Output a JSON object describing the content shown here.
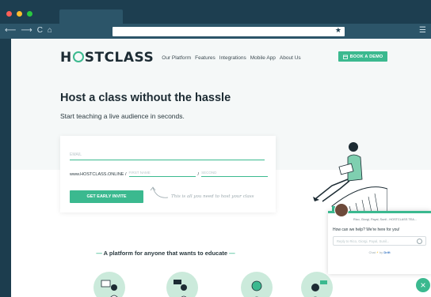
{
  "browser": {
    "nav_back": "⟵",
    "nav_forward": "⟶",
    "reload": "C",
    "home": "⌂",
    "star": "★",
    "menu": "☰",
    "dot_colors": [
      "#ff5f57",
      "#febc2e",
      "#28c840"
    ]
  },
  "header": {
    "logo_left": "H",
    "logo_right": "STCLASS",
    "nav_links": [
      "Our Platform",
      "Features",
      "Integrations",
      "Mobile App",
      "About Us"
    ],
    "demo_button": "BOOK A DEMO",
    "demo_icon": "calendar-icon"
  },
  "hero": {
    "title": "Host a class without the hassle",
    "subtitle": "Start teaching a live audience in seconds."
  },
  "form": {
    "email_placeholder": "EMAIL",
    "url_prefix": "www.HOSTCLASS.ONLINE /",
    "first_name_placeholder": "FIRST NAME",
    "slash": "/",
    "second_name_placeholder": "SECOND",
    "invite_button": "GET EARLY INVITE",
    "hint": "This is all you need to host your class"
  },
  "section": {
    "tagline": "A platform for anyone that wants to educate",
    "dash": "—"
  },
  "chat": {
    "names": "Rico, Giorgi, Payal, Sunil - HOSTCLASS TEA...",
    "message": "How can we help? We're here for you!",
    "reply_placeholder": "Reply to Rico, Giorgi, Payal, Sunil...",
    "footer_prefix": "Chat",
    "footer_bolt": "⚡",
    "footer_by": "by",
    "footer_brand": "Drift",
    "close_icon": "×"
  },
  "colors": {
    "accent": "#3bb98f",
    "chrome": "#1d3e50",
    "dark_text": "#1c2b33"
  }
}
